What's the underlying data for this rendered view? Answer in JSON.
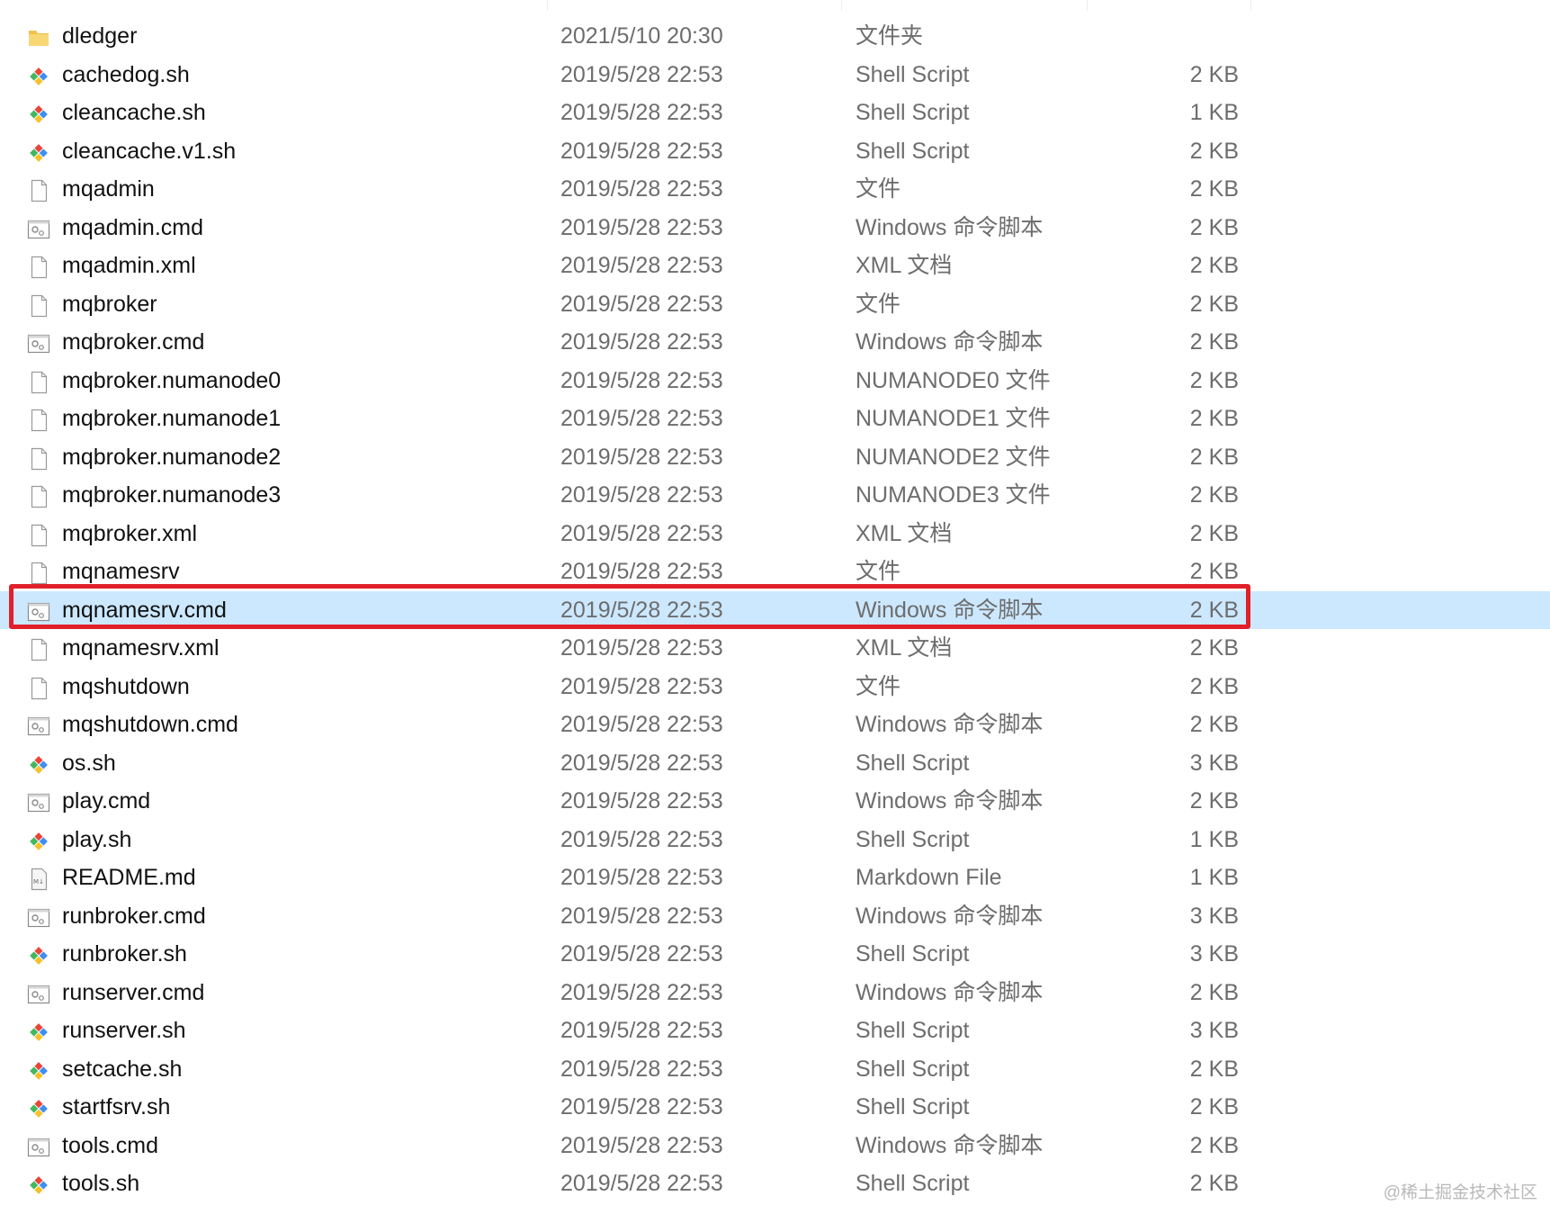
{
  "files": [
    {
      "name": "dledger",
      "date": "2021/5/10 20:30",
      "type": "文件夹",
      "size": "",
      "icon": "folder-icon"
    },
    {
      "name": "cachedog.sh",
      "date": "2019/5/28 22:53",
      "type": "Shell Script",
      "size": "2 KB",
      "icon": "shell-script-icon"
    },
    {
      "name": "cleancache.sh",
      "date": "2019/5/28 22:53",
      "type": "Shell Script",
      "size": "1 KB",
      "icon": "shell-script-icon"
    },
    {
      "name": "cleancache.v1.sh",
      "date": "2019/5/28 22:53",
      "type": "Shell Script",
      "size": "2 KB",
      "icon": "shell-script-icon"
    },
    {
      "name": "mqadmin",
      "date": "2019/5/28 22:53",
      "type": "文件",
      "size": "2 KB",
      "icon": "blank-file-icon"
    },
    {
      "name": "mqadmin.cmd",
      "date": "2019/5/28 22:53",
      "type": "Windows 命令脚本",
      "size": "2 KB",
      "icon": "cmd-file-icon"
    },
    {
      "name": "mqadmin.xml",
      "date": "2019/5/28 22:53",
      "type": "XML 文档",
      "size": "2 KB",
      "icon": "blank-file-icon"
    },
    {
      "name": "mqbroker",
      "date": "2019/5/28 22:53",
      "type": "文件",
      "size": "2 KB",
      "icon": "blank-file-icon"
    },
    {
      "name": "mqbroker.cmd",
      "date": "2019/5/28 22:53",
      "type": "Windows 命令脚本",
      "size": "2 KB",
      "icon": "cmd-file-icon"
    },
    {
      "name": "mqbroker.numanode0",
      "date": "2019/5/28 22:53",
      "type": "NUMANODE0 文件",
      "size": "2 KB",
      "icon": "blank-file-icon"
    },
    {
      "name": "mqbroker.numanode1",
      "date": "2019/5/28 22:53",
      "type": "NUMANODE1 文件",
      "size": "2 KB",
      "icon": "blank-file-icon"
    },
    {
      "name": "mqbroker.numanode2",
      "date": "2019/5/28 22:53",
      "type": "NUMANODE2 文件",
      "size": "2 KB",
      "icon": "blank-file-icon"
    },
    {
      "name": "mqbroker.numanode3",
      "date": "2019/5/28 22:53",
      "type": "NUMANODE3 文件",
      "size": "2 KB",
      "icon": "blank-file-icon"
    },
    {
      "name": "mqbroker.xml",
      "date": "2019/5/28 22:53",
      "type": "XML 文档",
      "size": "2 KB",
      "icon": "blank-file-icon"
    },
    {
      "name": "mqnamesrv",
      "date": "2019/5/28 22:53",
      "type": "文件",
      "size": "2 KB",
      "icon": "blank-file-icon"
    },
    {
      "name": "mqnamesrv.cmd",
      "date": "2019/5/28 22:53",
      "type": "Windows 命令脚本",
      "size": "2 KB",
      "icon": "cmd-file-icon",
      "selected": true
    },
    {
      "name": "mqnamesrv.xml",
      "date": "2019/5/28 22:53",
      "type": "XML 文档",
      "size": "2 KB",
      "icon": "blank-file-icon"
    },
    {
      "name": "mqshutdown",
      "date": "2019/5/28 22:53",
      "type": "文件",
      "size": "2 KB",
      "icon": "blank-file-icon"
    },
    {
      "name": "mqshutdown.cmd",
      "date": "2019/5/28 22:53",
      "type": "Windows 命令脚本",
      "size": "2 KB",
      "icon": "cmd-file-icon"
    },
    {
      "name": "os.sh",
      "date": "2019/5/28 22:53",
      "type": "Shell Script",
      "size": "3 KB",
      "icon": "shell-script-icon"
    },
    {
      "name": "play.cmd",
      "date": "2019/5/28 22:53",
      "type": "Windows 命令脚本",
      "size": "2 KB",
      "icon": "cmd-file-icon"
    },
    {
      "name": "play.sh",
      "date": "2019/5/28 22:53",
      "type": "Shell Script",
      "size": "1 KB",
      "icon": "shell-script-icon"
    },
    {
      "name": "README.md",
      "date": "2019/5/28 22:53",
      "type": "Markdown File",
      "size": "1 KB",
      "icon": "markdown-file-icon"
    },
    {
      "name": "runbroker.cmd",
      "date": "2019/5/28 22:53",
      "type": "Windows 命令脚本",
      "size": "3 KB",
      "icon": "cmd-file-icon"
    },
    {
      "name": "runbroker.sh",
      "date": "2019/5/28 22:53",
      "type": "Shell Script",
      "size": "3 KB",
      "icon": "shell-script-icon"
    },
    {
      "name": "runserver.cmd",
      "date": "2019/5/28 22:53",
      "type": "Windows 命令脚本",
      "size": "2 KB",
      "icon": "cmd-file-icon"
    },
    {
      "name": "runserver.sh",
      "date": "2019/5/28 22:53",
      "type": "Shell Script",
      "size": "3 KB",
      "icon": "shell-script-icon"
    },
    {
      "name": "setcache.sh",
      "date": "2019/5/28 22:53",
      "type": "Shell Script",
      "size": "2 KB",
      "icon": "shell-script-icon"
    },
    {
      "name": "startfsrv.sh",
      "date": "2019/5/28 22:53",
      "type": "Shell Script",
      "size": "2 KB",
      "icon": "shell-script-icon"
    },
    {
      "name": "tools.cmd",
      "date": "2019/5/28 22:53",
      "type": "Windows 命令脚本",
      "size": "2 KB",
      "icon": "cmd-file-icon"
    },
    {
      "name": "tools.sh",
      "date": "2019/5/28 22:53",
      "type": "Shell Script",
      "size": "2 KB",
      "icon": "shell-script-icon"
    }
  ],
  "highlight_color": "#e0202a",
  "selection_color": "#cce8ff",
  "watermark": "@稀土掘金技术社区"
}
